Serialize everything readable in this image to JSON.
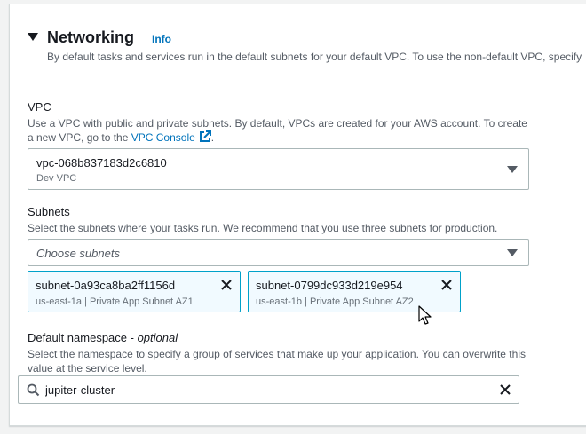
{
  "networking": {
    "title": "Networking",
    "info_label": "Info",
    "description": "By default tasks and services run in the default subnets for your default VPC. To use the non-default VPC, specify"
  },
  "vpc": {
    "label": "VPC",
    "hint_prefix": "Use a VPC with public and private subnets. By default, VPCs are created for your AWS account. To create a new VPC, go to the ",
    "hint_link": "VPC Console",
    "hint_suffix": ".",
    "selected_value": "vpc-068b837183d2c6810",
    "selected_description": "Dev VPC"
  },
  "subnets": {
    "label": "Subnets",
    "hint": "Select the subnets where your tasks run. We recommend that you use three subnets for production.",
    "placeholder": "Choose subnets",
    "tokens": [
      {
        "name": "subnet-0a93ca8ba2ff1156d",
        "description": "us-east-1a | Private App Subnet AZ1"
      },
      {
        "name": "subnet-0799dc933d219e954",
        "description": "us-east-1b | Private App Subnet AZ2"
      }
    ]
  },
  "namespace": {
    "label": "Default namespace - ",
    "label_optional": "optional",
    "hint": "Select the namespace to specify a group of services that make up your application. You can overwrite this value at the service level.",
    "value": "jupiter-cluster"
  },
  "icons": {
    "caret": "caret-down-icon",
    "external": "external-link-icon",
    "dropdown": "chevron-down-icon",
    "dismiss": "close-icon",
    "search": "search-icon",
    "cursor": "mouse-pointer-icon"
  },
  "colors": {
    "link": "#0073bb",
    "token_border": "#00a1c9",
    "token_bg": "#f1faff"
  }
}
